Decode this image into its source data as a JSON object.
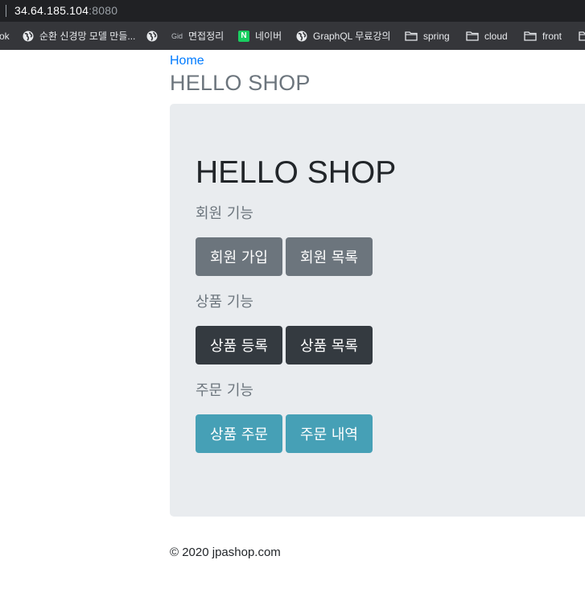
{
  "browser": {
    "url_host": "34.64.185.104",
    "url_port": ":8080",
    "bookmarks": [
      {
        "label": "ok",
        "icon": "none"
      },
      {
        "label": "순환 신경망 모델 만들...",
        "icon": "globe-icon"
      },
      {
        "label": "",
        "icon": "globe-icon"
      },
      {
        "label": "면접정리",
        "icon": "gid-icon",
        "icon_text": "Gid"
      },
      {
        "label": "네이버",
        "icon": "naver-icon",
        "icon_text": "N"
      },
      {
        "label": "GraphQL 무료강의",
        "icon": "globe-icon"
      },
      {
        "label": "spring",
        "icon": "folder-icon"
      },
      {
        "label": "cloud",
        "icon": "folder-icon"
      },
      {
        "label": "front",
        "icon": "folder-icon"
      }
    ]
  },
  "header": {
    "home_link": "Home",
    "title": "HELLO SHOP"
  },
  "jumbotron": {
    "title": "HELLO SHOP",
    "sections": [
      {
        "label": "회원 기능",
        "buttons": [
          "회원 가입",
          "회원 목록"
        ],
        "style": "secondary"
      },
      {
        "label": "상품 기능",
        "buttons": [
          "상품 등록",
          "상품 목록"
        ],
        "style": "dark"
      },
      {
        "label": "주문 기능",
        "buttons": [
          "상품 주문",
          "주문 내역"
        ],
        "style": "info"
      }
    ]
  },
  "footer": {
    "text": "© 2020 jpashop.com"
  },
  "colors": {
    "primary_link": "#007bff",
    "secondary": "#6c757d",
    "dark": "#343a40",
    "info": "#46a0b6",
    "jumbotron_bg": "#e9ecef"
  }
}
